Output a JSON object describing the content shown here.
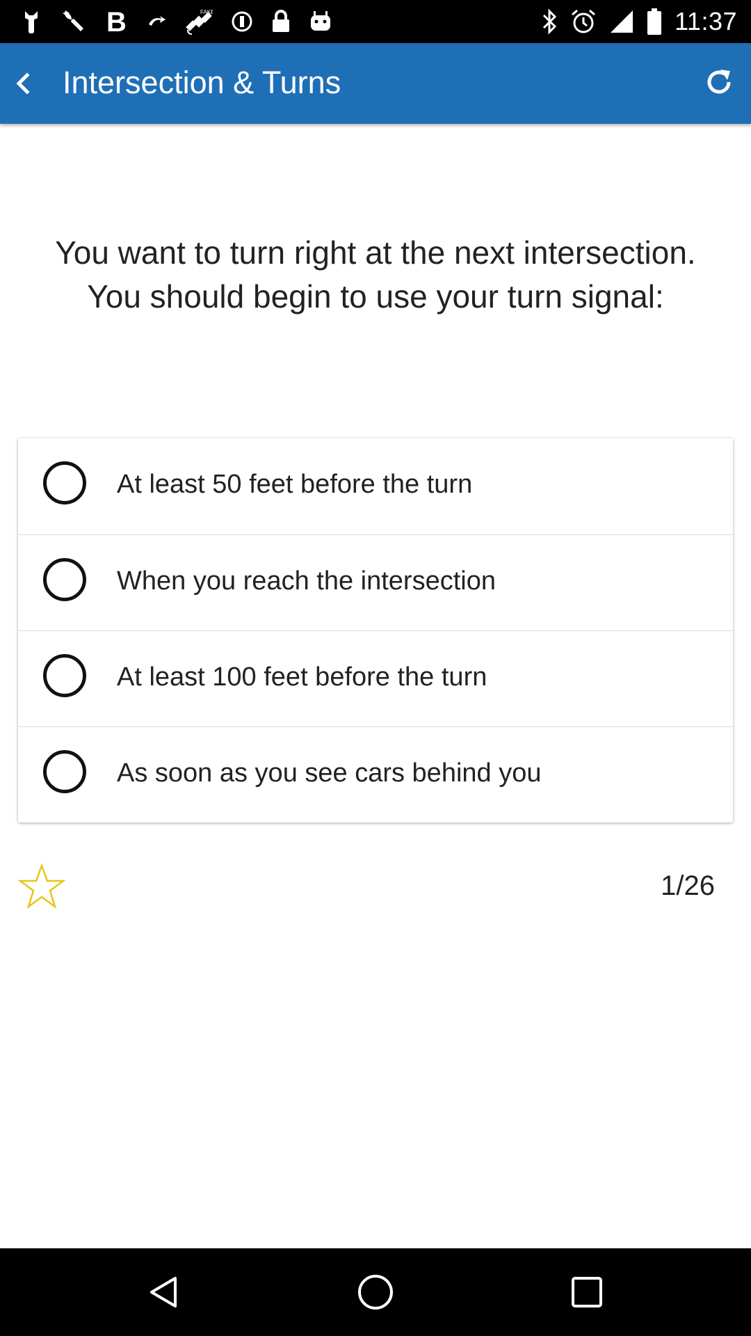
{
  "status_bar": {
    "time": "11:37",
    "left_icons": [
      "wrench-icon",
      "bold-b-icon",
      "sync-icon",
      "satellite-fake-icon",
      "info-circle-icon",
      "lock-icon",
      "android-icon"
    ],
    "right_icons": [
      "bluetooth-icon",
      "alarm-icon",
      "signal-icon",
      "battery-icon"
    ]
  },
  "app_bar": {
    "title": "Intersection & Turns",
    "color": "#1f6fb7"
  },
  "question": {
    "text": "You want to turn right at the next intersection. You should begin to use your turn signal:"
  },
  "answers": [
    {
      "label": "At least 50 feet before the turn",
      "selected": false
    },
    {
      "label": "When you reach the intersection",
      "selected": false
    },
    {
      "label": "At least 100 feet before the turn",
      "selected": false
    },
    {
      "label": "As soon as you see cars behind you",
      "selected": false
    }
  ],
  "footer": {
    "favorite_icon": "star-outline-icon",
    "star_color": "#e6c619",
    "counter": "1/26"
  },
  "nav_bar": {
    "buttons": [
      "back-nav-icon",
      "home-nav-icon",
      "recents-nav-icon"
    ]
  }
}
